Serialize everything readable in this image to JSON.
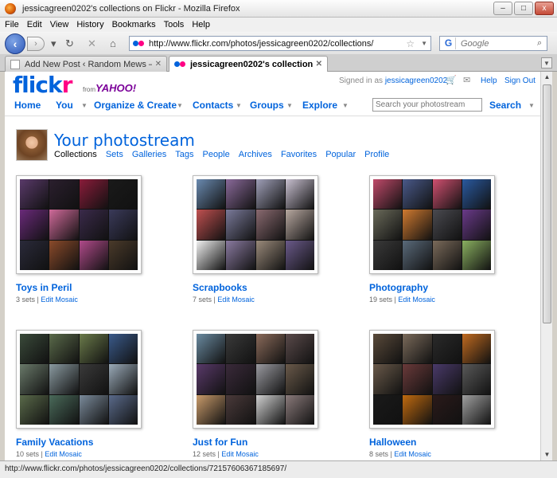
{
  "window": {
    "title": "jessicagreen0202's collections on Flickr - Mozilla Firefox",
    "buttons": [
      "–",
      "□",
      "x"
    ]
  },
  "menu": [
    "File",
    "Edit",
    "View",
    "History",
    "Bookmarks",
    "Tools",
    "Help"
  ],
  "toolbar": {
    "url": "http://www.flickr.com/photos/jessicagreen0202/collections/",
    "search_placeholder": "Google",
    "back_icon": "arrow-left",
    "forward_icon": "arrow-right",
    "reload_icon": "reload",
    "stop_icon": "x",
    "home_icon": "home"
  },
  "tabs": [
    {
      "label": "Add New Post ‹ Random Mews — ...",
      "active": false
    },
    {
      "label": "jessicagreen0202's collections on ...",
      "active": true
    }
  ],
  "status": "http://www.flickr.com/photos/jessicagreen0202/collections/72157606367185697/",
  "flickr": {
    "logo_a": "flick",
    "logo_b": "r",
    "from": "from",
    "yahoo": "YAHOO!",
    "signed_in_label": "Signed in as",
    "username": "jessicagreen0202",
    "help": "Help",
    "sign_out": "Sign Out",
    "nav": {
      "home": "Home",
      "you": "You",
      "organize": "Organize & Create",
      "contacts": "Contacts",
      "groups": "Groups",
      "explore": "Explore"
    },
    "search_placeholder": "Search your photostream",
    "search_button": "Search"
  },
  "photostream": {
    "title": "Your photostream",
    "subnav": [
      "Collections",
      "Sets",
      "Galleries",
      "Tags",
      "People",
      "Archives",
      "Favorites",
      "Popular",
      "Profile"
    ]
  },
  "collections": [
    {
      "title": "Toys in Peril",
      "sets": "3 sets",
      "edit": "Edit Mosaic",
      "tiles": [
        "#5a3a6a",
        "#2b1f2e",
        "#8a1c3a",
        "#1a1a1a",
        "#6a2a7a",
        "#d06a9a",
        "#3a2a4a",
        "#3a3a5a",
        "#2a2a3a",
        "#8a4a2a",
        "#b04a8a",
        "#4a3a2a"
      ]
    },
    {
      "title": "Scrapbooks",
      "sets": "7 sets",
      "edit": "Edit Mosaic",
      "tiles": [
        "#6a8ab0",
        "#8a6a9a",
        "#a0a0b8",
        "#c8c0d0",
        "#c05050",
        "#7a7a9a",
        "#8a6a70",
        "#b8a8a0",
        "#f0f0f0",
        "#8a7aa0",
        "#9a8a7a",
        "#6a5a8a"
      ]
    },
    {
      "title": "Photography",
      "sets": "19 sets",
      "edit": "Edit Mosaic",
      "tiles": [
        "#c04a6a",
        "#4a5a8a",
        "#d05070",
        "#2a5aa0",
        "#6a6a5a",
        "#d07a30",
        "#4a4a50",
        "#6a3a8a",
        "#3a3a3a",
        "#5a6a7a",
        "#7a6a5a",
        "#8ab060"
      ]
    },
    {
      "title": "Family Vacations",
      "sets": "10 sets",
      "edit": "Edit Mosaic",
      "tiles": [
        "#3a4a3a",
        "#5a6a4a",
        "#6a7a4a",
        "#3a5a8a",
        "#6a7a6a",
        "#8a9aa0",
        "#3a3a3a",
        "#9aaab8",
        "#5a6a4a",
        "#4a6a5a",
        "#7a8a9a",
        "#5a6a8a"
      ]
    },
    {
      "title": "Just for Fun",
      "sets": "12 sets",
      "edit": "Edit Mosaic",
      "tiles": [
        "#6a8aa0",
        "#3a3a3a",
        "#8a6a5a",
        "#5a4a4a",
        "#5a3a6a",
        "#3a2a3a",
        "#9a9aa0",
        "#6a5a4a",
        "#c89a6a",
        "#4a3a3a",
        "#d0d0d0",
        "#8a7a7a"
      ]
    },
    {
      "title": "Halloween",
      "sets": "8 sets",
      "edit": "Edit Mosaic",
      "tiles": [
        "#5a4a3a",
        "#7a6a5a",
        "#2a2a2a",
        "#c06a20",
        "#6a5a4a",
        "#6a3a3a",
        "#4a3a6a",
        "#5a5a5a",
        "#1a1a1a",
        "#c06a10",
        "#2a1a1a",
        "#a0a0a0"
      ]
    }
  ]
}
